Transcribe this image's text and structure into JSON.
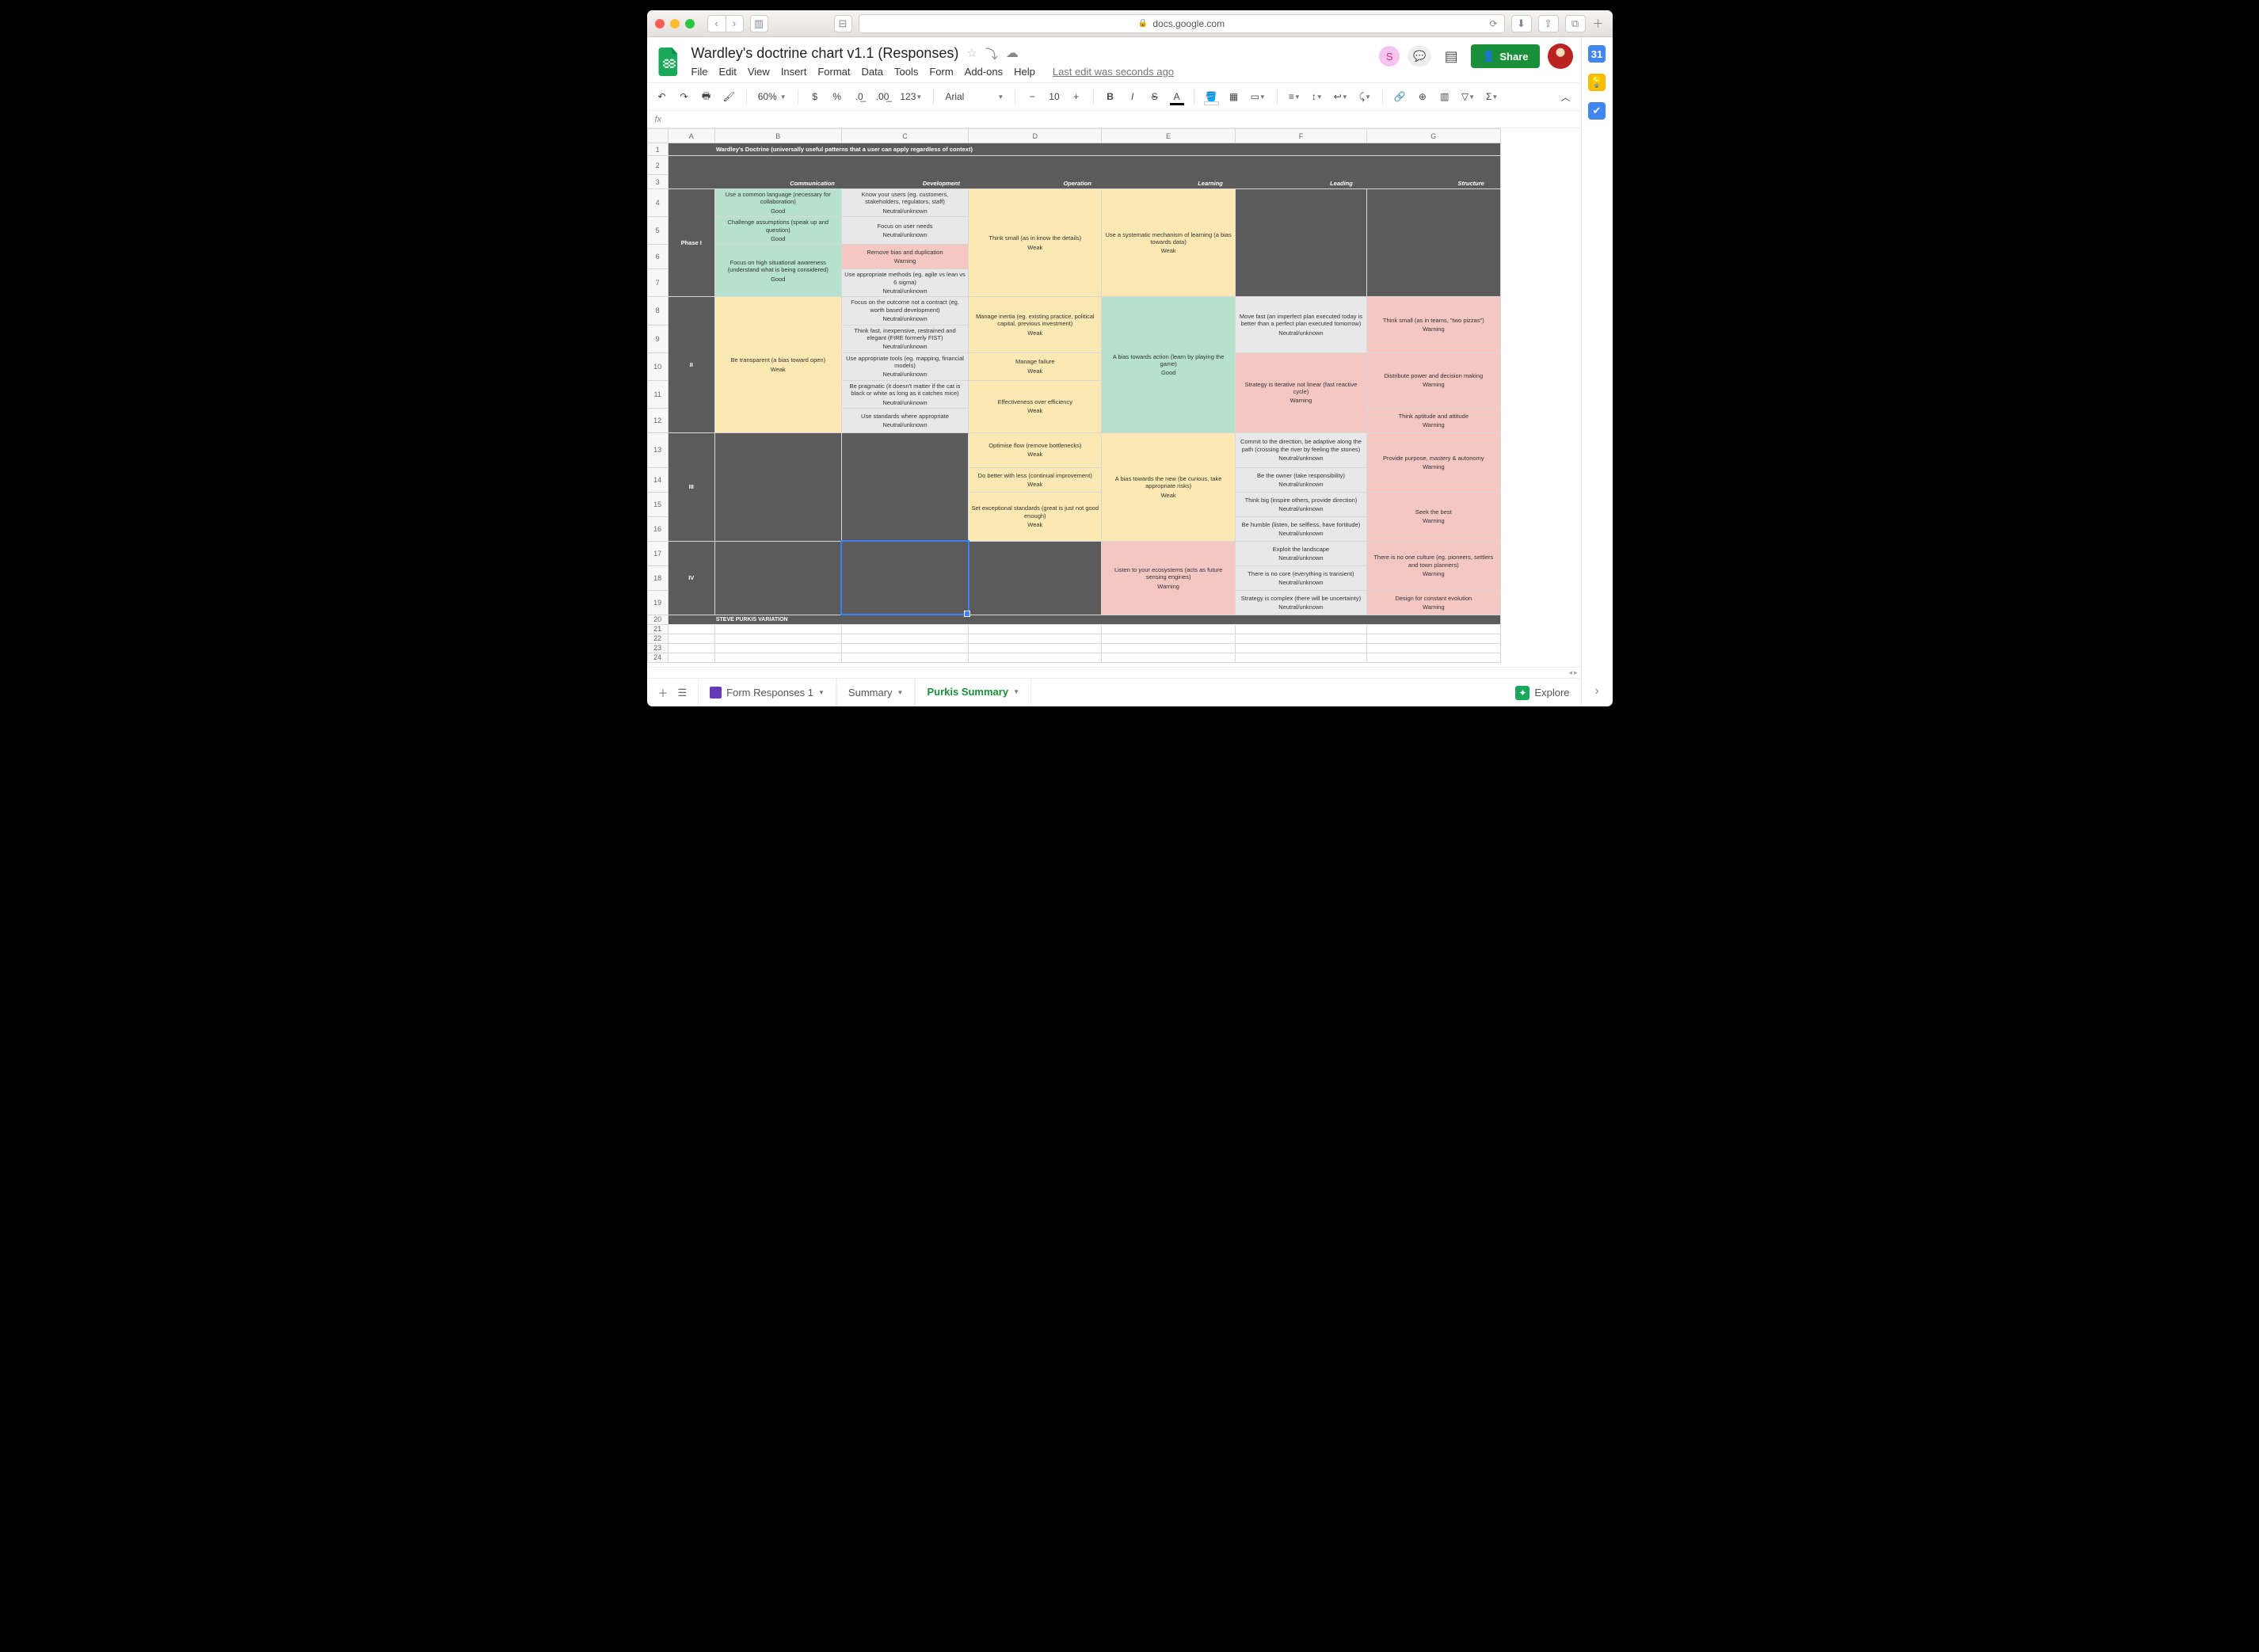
{
  "browser": {
    "url": "docs.google.com"
  },
  "doc": {
    "title": "Wardley's doctrine chart v1.1 (Responses)",
    "last_edit": "Last edit was seconds ago"
  },
  "menu": {
    "file": "File",
    "edit": "Edit",
    "view": "View",
    "insert": "Insert",
    "format": "Format",
    "data": "Data",
    "tools": "Tools",
    "form": "Form",
    "addons": "Add-ons",
    "help": "Help"
  },
  "toolbar": {
    "zoom": "60%",
    "font": "Arial",
    "size": "10",
    "fmt": "123",
    "share": "Share",
    "collab": "S"
  },
  "fx": "fx",
  "cols": [
    "",
    "A",
    "B",
    "C",
    "D",
    "E",
    "F",
    "G"
  ],
  "rows": [
    "1",
    "2",
    "3",
    "4",
    "5",
    "6",
    "7",
    "8",
    "9",
    "10",
    "11",
    "12",
    "13",
    "14",
    "15",
    "16",
    "17",
    "18",
    "19",
    "20",
    "21",
    "22",
    "23",
    "24"
  ],
  "sheet": {
    "title": "Wardley's Doctrine (universally useful patterns that a user can apply regardless of context)",
    "hdr": {
      "b": "Communication",
      "c": "Development",
      "d": "Operation",
      "e": "Learning",
      "f": "Leading",
      "g": "Structure"
    },
    "phases": {
      "I": "Phase I",
      "II": "II",
      "III": "III",
      "IV": "IV"
    },
    "footer": "STEVE PURKIS VARIATION",
    "rating": {
      "good": "Good",
      "neutral": "Neutral/unknown",
      "warn": "Warning",
      "weak": "Weak"
    },
    "c": {
      "b4": "Use a common language (necessary for collaboration)",
      "b5": "Challenge assumptions (speak up and question)",
      "b67": "Focus on high situational awareness (understand what is being considered)",
      "c4": "Know your users (eg. customers, stakeholders, regulators, staff)",
      "c5": "Focus on user needs",
      "c6": "Remove bias and duplication",
      "c7": "Use appropriate methods (eg. agile  vs lean vs 6 sigma)",
      "d47": "Think small (as in know the details)",
      "e47": "Use a systematic mechanism of learning (a bias towards data)",
      "b812": "Be transparent (a bias toward open)",
      "c8": "Focus on the outcome not a contract (eg. worth based development)",
      "c9": "Think fast, inexpensive, restrained and elegant (FIRE formerly FIST)",
      "c10": "Use appropriate tools (eg. mapping, financial models)",
      "c11": "Be pragmatic (it doesn't matter if the cat is black or white as long as it catches mice)",
      "c12": "Use standards where appropriate",
      "d89": "Manage inertia (eg. existing practice, political capital, previous investment)",
      "d10": "Manage failure",
      "d1112": "Effectiveness over efficiency",
      "e812": "A bias towards action (learn by playing the game)",
      "f89": "Move fast (an imperfect plan executed today is better than a perfect plan executed tomorrow)",
      "f1012": "Strategy is iterative not linear (fast reactive cycle)",
      "g89": "Think small (as in teams, \"two pizzas\")",
      "g1011": "Distribute power and decision making",
      "g12": "Think aptitude and attitude",
      "d13": "Optimise flow (remove bottlenecks)",
      "d14": "Do better with less (continual improvement)",
      "d1516": "Set exceptional standards (great is just not good enough)",
      "e1316": "A bias towards the new (be curious, take appropriate risks)",
      "f13": "Commit to the direction, be adaptive along the path (crossing the river by feeling the stones)",
      "f14": "Be the owner (take responsibility)",
      "f15": "Think big (inspire others, provide direction)",
      "f16": "Be humble (listen, be selfless, have fortitude)",
      "g1314": "Provide purpose, mastery & autonomy",
      "g1516": "Seek the best",
      "e1719": "Listen to your ecosystems (acts as future sensing engines)",
      "f17": "Exploit the landscape",
      "f18": "There is no core (everything is transient)",
      "f19": "Strategy is complex (there will be uncertainty)",
      "g1718": "There is no one culture (eg. pioneers, settlers and town planners)",
      "g19": "Design for constant evolution"
    }
  },
  "tabs": {
    "t1": "Form Responses 1",
    "t2": "Summary",
    "t3": "Purkis Summary",
    "explore": "Explore"
  },
  "sidepanel": {
    "cal": "31"
  }
}
